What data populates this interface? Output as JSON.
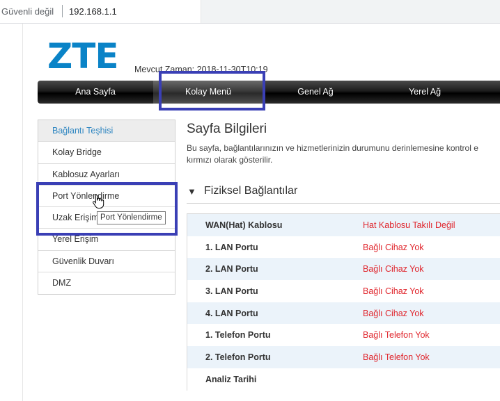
{
  "browser": {
    "security_label": "Güvenli değil",
    "url": "192.168.1.1"
  },
  "header": {
    "logo": "ZTE",
    "current_time": "Mevcut Zaman: 2018-11-30T10:19"
  },
  "topnav": {
    "tabs": [
      {
        "label": "Ana Sayfa"
      },
      {
        "label": "Kolay Menü"
      },
      {
        "label": "Genel Ağ"
      },
      {
        "label": "Yerel Ağ"
      }
    ],
    "active": "Kolay Menü"
  },
  "sidebar": {
    "items": [
      {
        "label": "Bağlantı Teşhisi"
      },
      {
        "label": "Kolay Bridge"
      },
      {
        "label": "Kablosuz Ayarları"
      },
      {
        "label": "Port Yönlendirme"
      },
      {
        "label": "Uzak Erişim"
      },
      {
        "label": "Yerel Erişim"
      },
      {
        "label": "Güvenlik Duvarı"
      },
      {
        "label": "DMZ"
      }
    ],
    "tooltip": "Port Yönlendirme"
  },
  "main": {
    "title": "Sayfa Bilgileri",
    "description_line1": "Bu sayfa, bağlantılarınızın ve hizmetlerinizin durumunu derinlemesine kontrol e",
    "description_line2": "kırmızı olarak gösterilir.",
    "section": {
      "title": "Fiziksel Bağlantılar",
      "rows": [
        {
          "key": "WAN(Hat) Kablosu",
          "value": "Hat Kablosu Takılı Değil"
        },
        {
          "key": "1. LAN Portu",
          "value": "Bağlı Cihaz Yok"
        },
        {
          "key": "2. LAN Portu",
          "value": "Bağlı Cihaz Yok"
        },
        {
          "key": "3. LAN Portu",
          "value": "Bağlı Cihaz Yok"
        },
        {
          "key": "4. LAN Portu",
          "value": "Bağlı Cihaz Yok"
        },
        {
          "key": "1. Telefon Portu",
          "value": "Bağlı Telefon Yok"
        },
        {
          "key": "2. Telefon Portu",
          "value": "Bağlı Telefon Yok"
        },
        {
          "key": "Analiz Tarihi",
          "value": ""
        }
      ]
    }
  },
  "colors": {
    "brand": "#0a83c7",
    "highlight": "#3a3fb5",
    "error": "#e0262d",
    "active_link": "#2e86c1"
  }
}
